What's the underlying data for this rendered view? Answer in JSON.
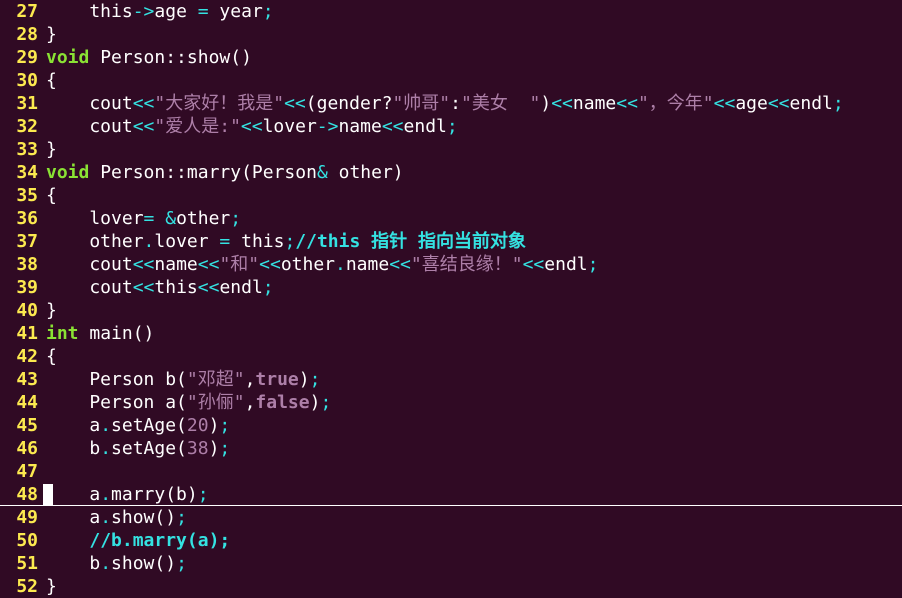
{
  "editor": {
    "cursor_line": 48,
    "lines": [
      {
        "n": "27",
        "tokens": [
          [
            "plain",
            "    this"
          ],
          [
            "op",
            "->"
          ],
          [
            "plain",
            "age "
          ],
          [
            "op",
            "="
          ],
          [
            "plain",
            " year"
          ],
          [
            "op",
            ";"
          ]
        ]
      },
      {
        "n": "28",
        "tokens": [
          [
            "plain",
            "}"
          ]
        ]
      },
      {
        "n": "29",
        "tokens": [
          [
            "type",
            "void"
          ],
          [
            "plain",
            " Person::show()"
          ]
        ]
      },
      {
        "n": "30",
        "tokens": [
          [
            "plain",
            "{"
          ]
        ]
      },
      {
        "n": "31",
        "tokens": [
          [
            "plain",
            "    cout"
          ],
          [
            "op",
            "<<"
          ],
          [
            "str",
            "\"大家好！我是\""
          ],
          [
            "op",
            "<<"
          ],
          [
            "plain",
            "(gender?"
          ],
          [
            "str",
            "\"帅哥\""
          ],
          [
            "plain",
            ":"
          ],
          [
            "str",
            "\"美女  \""
          ],
          [
            "plain",
            ")"
          ],
          [
            "op",
            "<<"
          ],
          [
            "plain",
            "name"
          ],
          [
            "op",
            "<<"
          ],
          [
            "str",
            "\"，今年\""
          ],
          [
            "op",
            "<<"
          ],
          [
            "plain",
            "age"
          ],
          [
            "op",
            "<<"
          ],
          [
            "plain",
            "endl"
          ],
          [
            "op",
            ";"
          ]
        ]
      },
      {
        "n": "32",
        "tokens": [
          [
            "plain",
            "    cout"
          ],
          [
            "op",
            "<<"
          ],
          [
            "str",
            "\"爱人是:\""
          ],
          [
            "op",
            "<<"
          ],
          [
            "plain",
            "lover"
          ],
          [
            "op",
            "->"
          ],
          [
            "plain",
            "name"
          ],
          [
            "op",
            "<<"
          ],
          [
            "plain",
            "endl"
          ],
          [
            "op",
            ";"
          ]
        ]
      },
      {
        "n": "33",
        "tokens": [
          [
            "plain",
            "}"
          ]
        ]
      },
      {
        "n": "34",
        "tokens": [
          [
            "type",
            "void"
          ],
          [
            "plain",
            " Person::marry(Person"
          ],
          [
            "op",
            "&"
          ],
          [
            "plain",
            " other)"
          ]
        ]
      },
      {
        "n": "35",
        "tokens": [
          [
            "plain",
            "{"
          ]
        ]
      },
      {
        "n": "36",
        "tokens": [
          [
            "plain",
            "    lover"
          ],
          [
            "op",
            "="
          ],
          [
            "plain",
            " "
          ],
          [
            "op",
            "&"
          ],
          [
            "plain",
            "other"
          ],
          [
            "op",
            ";"
          ]
        ]
      },
      {
        "n": "37",
        "tokens": [
          [
            "plain",
            "    other"
          ],
          [
            "op",
            "."
          ],
          [
            "plain",
            "lover "
          ],
          [
            "op",
            "="
          ],
          [
            "plain",
            " this"
          ],
          [
            "op",
            ";"
          ],
          [
            "comment",
            "//this 指针 指向当前对象"
          ]
        ]
      },
      {
        "n": "38",
        "tokens": [
          [
            "plain",
            "    cout"
          ],
          [
            "op",
            "<<"
          ],
          [
            "plain",
            "name"
          ],
          [
            "op",
            "<<"
          ],
          [
            "str",
            "\"和\""
          ],
          [
            "op",
            "<<"
          ],
          [
            "plain",
            "other"
          ],
          [
            "op",
            "."
          ],
          [
            "plain",
            "name"
          ],
          [
            "op",
            "<<"
          ],
          [
            "str",
            "\"喜结良缘！\""
          ],
          [
            "op",
            "<<"
          ],
          [
            "plain",
            "endl"
          ],
          [
            "op",
            ";"
          ]
        ]
      },
      {
        "n": "39",
        "tokens": [
          [
            "plain",
            "    cout"
          ],
          [
            "op",
            "<<"
          ],
          [
            "plain",
            "this"
          ],
          [
            "op",
            "<<"
          ],
          [
            "plain",
            "endl"
          ],
          [
            "op",
            ";"
          ]
        ]
      },
      {
        "n": "40",
        "tokens": [
          [
            "plain",
            "}"
          ]
        ]
      },
      {
        "n": "41",
        "tokens": [
          [
            "type",
            "int"
          ],
          [
            "plain",
            " main()"
          ]
        ]
      },
      {
        "n": "42",
        "tokens": [
          [
            "plain",
            "{"
          ]
        ]
      },
      {
        "n": "43",
        "tokens": [
          [
            "plain",
            "    Person b("
          ],
          [
            "str",
            "\"邓超\""
          ],
          [
            "plain",
            ","
          ],
          [
            "bool",
            "true"
          ],
          [
            "plain",
            ")"
          ],
          [
            "op",
            ";"
          ]
        ]
      },
      {
        "n": "44",
        "tokens": [
          [
            "plain",
            "    Person a("
          ],
          [
            "str",
            "\"孙俪\""
          ],
          [
            "plain",
            ","
          ],
          [
            "bool",
            "false"
          ],
          [
            "plain",
            ")"
          ],
          [
            "op",
            ";"
          ]
        ]
      },
      {
        "n": "45",
        "tokens": [
          [
            "plain",
            "    a"
          ],
          [
            "op",
            "."
          ],
          [
            "plain",
            "setAge("
          ],
          [
            "num",
            "20"
          ],
          [
            "plain",
            ")"
          ],
          [
            "op",
            ";"
          ]
        ]
      },
      {
        "n": "46",
        "tokens": [
          [
            "plain",
            "    b"
          ],
          [
            "op",
            "."
          ],
          [
            "plain",
            "setAge("
          ],
          [
            "num",
            "38"
          ],
          [
            "plain",
            ")"
          ],
          [
            "op",
            ";"
          ]
        ]
      },
      {
        "n": "47",
        "tokens": []
      },
      {
        "n": "48",
        "tokens": [
          [
            "plain",
            "    a"
          ],
          [
            "op",
            "."
          ],
          [
            "plain",
            "marry(b)"
          ],
          [
            "op",
            ";"
          ]
        ]
      },
      {
        "n": "49",
        "tokens": [
          [
            "plain",
            "    a"
          ],
          [
            "op",
            "."
          ],
          [
            "plain",
            "show()"
          ],
          [
            "op",
            ";"
          ]
        ]
      },
      {
        "n": "50",
        "tokens": [
          [
            "plain",
            "    "
          ],
          [
            "comment",
            "//b.marry(a);"
          ]
        ]
      },
      {
        "n": "51",
        "tokens": [
          [
            "plain",
            "    b"
          ],
          [
            "op",
            "."
          ],
          [
            "plain",
            "show()"
          ],
          [
            "op",
            ";"
          ]
        ]
      },
      {
        "n": "52",
        "tokens": [
          [
            "plain",
            "}"
          ]
        ]
      }
    ]
  },
  "colors": {
    "background": "#300a24",
    "line_number": "#fce94f",
    "operator": "#34e2e2",
    "type_keyword": "#8ae234",
    "string": "#ad7fa8",
    "comment": "#34e2e2",
    "text": "#ffffff"
  }
}
